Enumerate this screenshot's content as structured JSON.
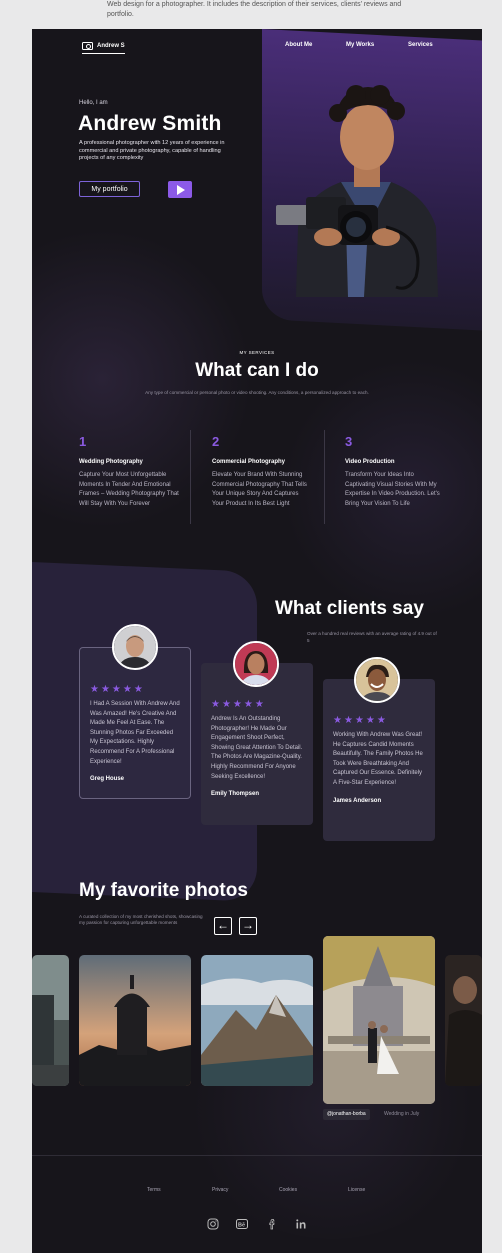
{
  "caption": "Web design for a photographer. It includes the description of their services, clients' reviews and portfolio.",
  "header": {
    "logo_text": "Andrew S",
    "nav": [
      "About Me",
      "My Works",
      "Services"
    ]
  },
  "hero": {
    "greeting": "Hello, I am",
    "name": "Andrew Smith",
    "intro": "A professional photographer with 12 years of experience in commercial and private photography, capable of handling projects of any complexity",
    "portfolio_button": "My portfolio"
  },
  "services": {
    "eyebrow": "MY SERVICES",
    "title": "What can I do",
    "subtitle": "Any type of commercial or personal photo or video shooting. Any conditions, a personalized approach to each.",
    "items": [
      {
        "num": "1",
        "title": "Wedding Photography",
        "desc": "Capture Your Most Unforgettable Moments In Tender And Emotional Frames – Wedding Photography That Will Stay With You Forever"
      },
      {
        "num": "2",
        "title": "Commercial Photography",
        "desc": "Elevate Your Brand With Stunning Commercial Photography That Tells Your Unique Story And Captures Your Product In Its Best Light"
      },
      {
        "num": "3",
        "title": "Video Production",
        "desc": "Transform Your Ideas Into Captivating Visual Stories With My Expertise In Video Production. Let's Bring Your Vision To Life"
      }
    ]
  },
  "clients": {
    "title": "What clients say",
    "subtitle": "Over a hundred real reviews with an average rating of 4.9 out of 5",
    "reviews": [
      {
        "stars": "★★★★★",
        "quote": "I Had A Session With Andrew And Was Amazed! He's Creative And Made Me Feel At Ease. The Stunning Photos Far Exceeded My Expectations. Highly Recommend For A Professional Experience!",
        "author": "Greg House"
      },
      {
        "stars": "★★★★★",
        "quote": "Andrew Is An Outstanding Photographer! He Made Our Engagement Shoot Perfect, Showing Great Attention To Detail. The Photos Are Magazine-Quality. Highly Recommend For Anyone Seeking Excellence!",
        "author": "Emily Thompsen"
      },
      {
        "stars": "★★★★★",
        "quote": "Working With Andrew Was Great! He Captures Candid Moments Beautifully. The Family Photos He Took Were Breathtaking And Captured Our Essence. Definitely A Five-Star Experience!",
        "author": "James Anderson"
      }
    ]
  },
  "photos": {
    "title": "My favorite photos",
    "subtitle": "A curated collection of my most cherished shots, showcasing my passion for capturing unforgettable moments",
    "arrow_prev": "←",
    "arrow_next": "→",
    "active_tag": "@jonathan-borba",
    "active_desc": "Wedding in July"
  },
  "footer": {
    "links": [
      "Terms",
      "Privacy",
      "Cookies",
      "License"
    ],
    "social_icons": [
      "instagram-icon",
      "behance-icon",
      "facebook-icon",
      "linkedin-icon"
    ]
  },
  "colors": {
    "accent": "#8a5ae0",
    "background": "#17151b",
    "panel": "#4a2e79"
  }
}
